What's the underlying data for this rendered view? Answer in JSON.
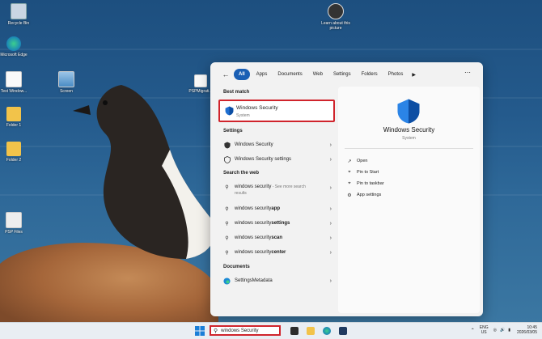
{
  "desktop": {
    "icons": [
      {
        "label": "Recycle Bin",
        "kind": "recycle"
      },
      {
        "label": "Microsoft Edge",
        "kind": "edge"
      },
      {
        "label": "Test Window...",
        "kind": "doc"
      },
      {
        "label": "Folder 1",
        "kind": "folder"
      },
      {
        "label": "Folder 2",
        "kind": "folder"
      },
      {
        "label": "PSP Files",
        "kind": "doc"
      },
      {
        "label": "Screen",
        "kind": "doc"
      },
      {
        "label": "PSPMigrati...",
        "kind": "doc"
      },
      {
        "label": "Learn about this picture",
        "kind": "camera"
      }
    ]
  },
  "search_panel": {
    "filters": [
      "All",
      "Apps",
      "Documents",
      "Web",
      "Settings",
      "Folders",
      "Photos"
    ],
    "active_filter": "All",
    "best_match_header": "Best match",
    "best_match": {
      "name": "Windows Security",
      "category": "System"
    },
    "settings_header": "Settings",
    "settings_items": [
      "Windows Security",
      "Windows Security settings"
    ],
    "web_header": "Search the web",
    "web_items": [
      {
        "prefix": "windows security",
        "bold": "",
        "suffix": " - See more search results"
      },
      {
        "prefix": "windows security ",
        "bold": "app",
        "suffix": ""
      },
      {
        "prefix": "windows security ",
        "bold": "settings",
        "suffix": ""
      },
      {
        "prefix": "windows security ",
        "bold": "scan",
        "suffix": ""
      },
      {
        "prefix": "windows security ",
        "bold": "center",
        "suffix": ""
      }
    ],
    "documents_header": "Documents",
    "document_items": [
      "SettingsMetadata"
    ],
    "detail": {
      "name": "Windows Security",
      "category": "System",
      "actions": [
        "Open",
        "Pin to Start",
        "Pin to taskbar",
        "App settings"
      ]
    }
  },
  "taskbar": {
    "search_value": "windows Security",
    "lang_top": "ENG",
    "lang_bottom": "US",
    "time": "10:45",
    "date": "2026/03/05"
  },
  "colors": {
    "accent": "#1a5fb4",
    "highlight": "#d0242c"
  }
}
